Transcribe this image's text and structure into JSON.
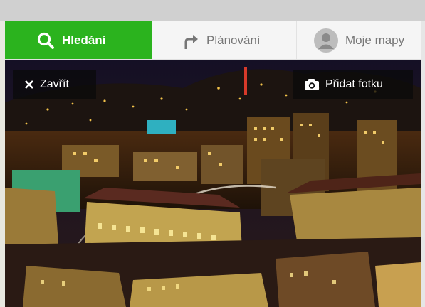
{
  "tabs": {
    "search": {
      "label": "Hledání",
      "icon": "search-icon",
      "color": "#2bb31e"
    },
    "planning": {
      "label": "Plánování",
      "icon": "route-turn-icon"
    },
    "my_maps": {
      "label": "Moje mapy",
      "icon": "user-avatar-icon"
    }
  },
  "photo": {
    "close_label": "Zavřít",
    "close_icon": "close-icon",
    "add_photo_label": "Přidat fotku",
    "add_photo_icon": "camera-icon"
  }
}
